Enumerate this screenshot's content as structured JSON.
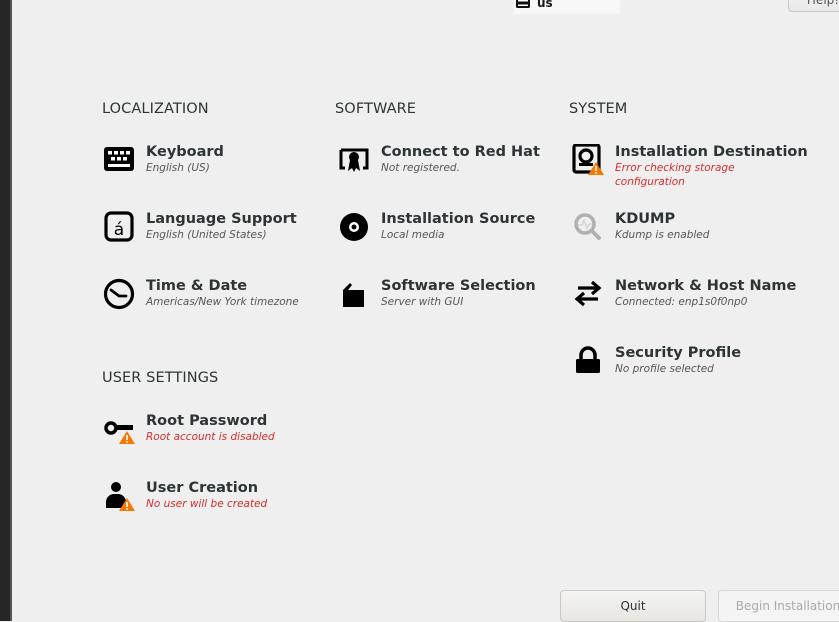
{
  "header": {
    "keyboard_layout": "us",
    "help_label": "Help!"
  },
  "sections": {
    "localization": {
      "title": "LOCALIZATION",
      "items": [
        {
          "title": "Keyboard",
          "status": "English (US)",
          "icon": "keyboard-icon",
          "error": false
        },
        {
          "title": "Language Support",
          "status": "English (United States)",
          "icon": "language-icon",
          "error": false
        },
        {
          "title": "Time & Date",
          "status": "Americas/New York timezone",
          "icon": "clock-icon",
          "error": false
        }
      ]
    },
    "software": {
      "title": "SOFTWARE",
      "items": [
        {
          "title": "Connect to Red Hat",
          "status": "Not registered.",
          "icon": "certificate-icon",
          "error": false
        },
        {
          "title": "Installation Source",
          "status": "Local media",
          "icon": "disc-icon",
          "error": false
        },
        {
          "title": "Software Selection",
          "status": "Server with GUI",
          "icon": "package-icon",
          "error": false
        }
      ]
    },
    "system": {
      "title": "SYSTEM",
      "items": [
        {
          "title": "Installation Destination",
          "status": "Error checking storage configuration",
          "icon": "harddisk-warning-icon",
          "error": true
        },
        {
          "title": "KDUMP",
          "status": "Kdump is enabled",
          "icon": "kdump-magnifier-icon",
          "error": false
        },
        {
          "title": "Network & Host Name",
          "status": "Connected: enp1s0f0np0",
          "icon": "network-arrows-icon",
          "error": false
        },
        {
          "title": "Security Profile",
          "status": "No profile selected",
          "icon": "lock-icon",
          "error": false
        }
      ]
    },
    "user_settings": {
      "title": "USER SETTINGS",
      "items": [
        {
          "title": "Root Password",
          "status": "Root account is disabled",
          "icon": "key-warning-icon",
          "error": true
        },
        {
          "title": "User Creation",
          "status": "No user will be created",
          "icon": "user-warning-icon",
          "error": true
        }
      ]
    }
  },
  "footer": {
    "quit_label": "Quit",
    "begin_label": "Begin Installation"
  },
  "colors": {
    "error_text": "#d02f2f",
    "warning_badge": "#f57900",
    "background": "#efefef"
  }
}
